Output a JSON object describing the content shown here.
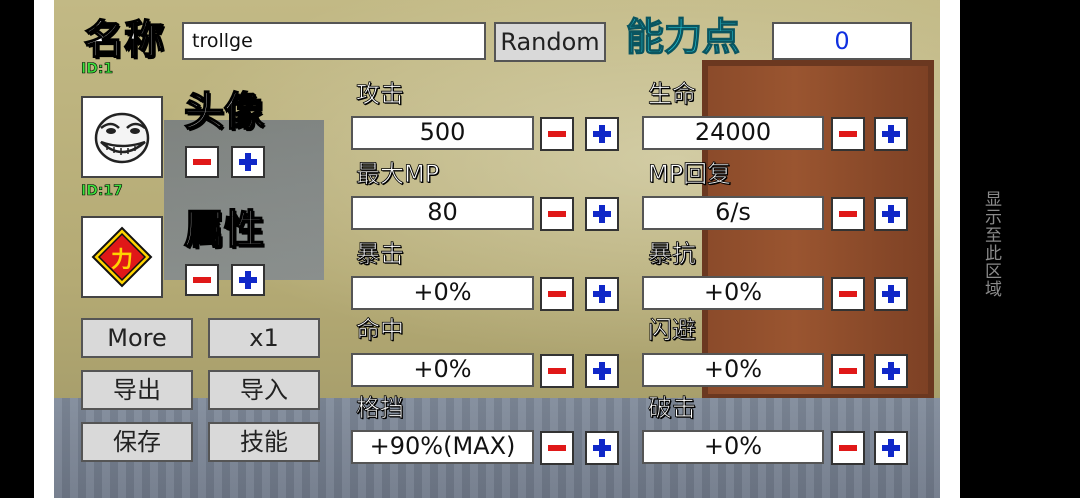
{
  "side_label": "显示至此区域",
  "name_section": {
    "title": "名称",
    "id_label": "ID:1",
    "name_value": "trollge",
    "random_label": "Random"
  },
  "ability_points": {
    "title": "能力点",
    "value": "0"
  },
  "avatar_section": {
    "title": "头像",
    "id_label": "ID:17"
  },
  "attribute_section": {
    "title": "属性",
    "emblem_char": "力"
  },
  "buttons": {
    "more": "More",
    "x1": "x1",
    "export": "导出",
    "import": "导入",
    "save": "保存",
    "skills": "技能"
  },
  "stats": {
    "attack": {
      "label": "攻击",
      "value": "500"
    },
    "hp": {
      "label": "生命",
      "value": "24000"
    },
    "max_mp": {
      "label": "最大MP",
      "value": "80"
    },
    "mp_regen": {
      "label": "MP回复",
      "value": "6/s"
    },
    "crit": {
      "label": "暴击",
      "value": "+0%"
    },
    "crit_resist": {
      "label": "暴抗",
      "value": "+0%"
    },
    "hit": {
      "label": "命中",
      "value": "+0%"
    },
    "dodge": {
      "label": "闪避",
      "value": "+0%"
    },
    "block": {
      "label": "格挡",
      "value": "+90%(MAX)"
    },
    "break": {
      "label": "破击",
      "value": "+0%"
    }
  },
  "colors": {
    "ability_title": "#29d3e6",
    "ability_value": "#1030e0",
    "id_text": "#3be03b",
    "minus": "#e01818",
    "plus": "#1028c8"
  },
  "icons": {
    "avatar": "troll-face-icon",
    "attribute": "strength-emblem-icon"
  }
}
